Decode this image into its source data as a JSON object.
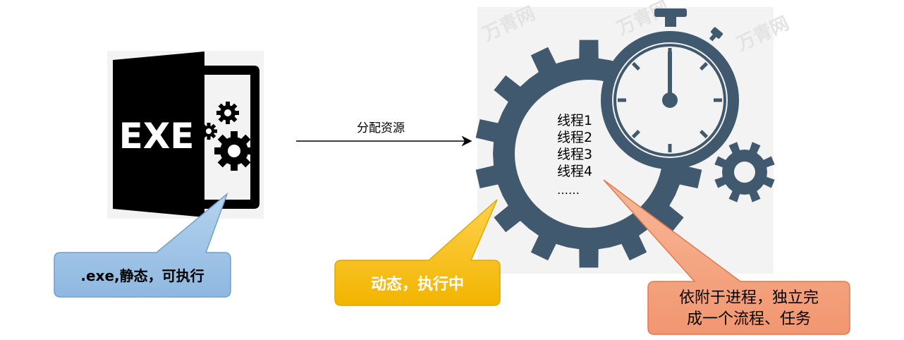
{
  "exe_icon": {
    "label": "EXE",
    "icon": "exe-file-gears-icon"
  },
  "arrow": {
    "label": "分配资源"
  },
  "threads": {
    "items": [
      "线程1",
      "线程2",
      "线程3",
      "线程4"
    ],
    "more": "……",
    "icon": "gear-stopwatch-icon"
  },
  "watermark": {
    "text": "万青网"
  },
  "callouts": {
    "exe": {
      "text": ".exe,静态，可执行",
      "fill": "#9dc3e6",
      "stroke": "#6f9fcc"
    },
    "process": {
      "text": "动态，执行中",
      "fill": "#ffc000",
      "stroke": "#e0a800"
    },
    "thread": {
      "line1": "依附于进程，独立完",
      "line2": "成一个流程、任务",
      "fill": "#f4a582",
      "stroke": "#e07a50"
    }
  },
  "colors": {
    "gear": "#41596e",
    "exe_black": "#000000",
    "panel_bg": "#f3f3f3"
  }
}
